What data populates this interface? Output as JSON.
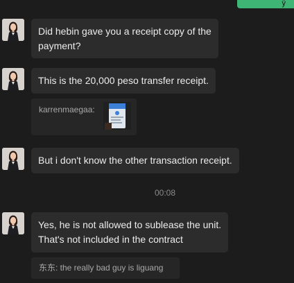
{
  "top_sent": {
    "label": "ÿ"
  },
  "messages": [
    {
      "lines": [
        "Did hebin gave you a receipt copy of the",
        "payment?"
      ]
    },
    {
      "lines": [
        "This is the 20,000 peso transfer receipt."
      ]
    },
    {
      "lines": [
        "But i don't know the other transaction receipt."
      ]
    },
    {
      "lines": [
        "Yes, he is not allowed to sublease the unit.",
        "That's not included in the contract"
      ]
    }
  ],
  "quote_image": {
    "sender": "karrenmaegaa:",
    "thumbnail_icon": "receipt-screenshot-thumbnail"
  },
  "quote_text": {
    "text": "东东: the really bad guy is liguang"
  },
  "time_separator": "00:08",
  "colors": {
    "background": "#1c1c1c",
    "bubble": "#2c2c2c",
    "sent_bubble": "#3eb575",
    "quote_bg": "#262626"
  }
}
